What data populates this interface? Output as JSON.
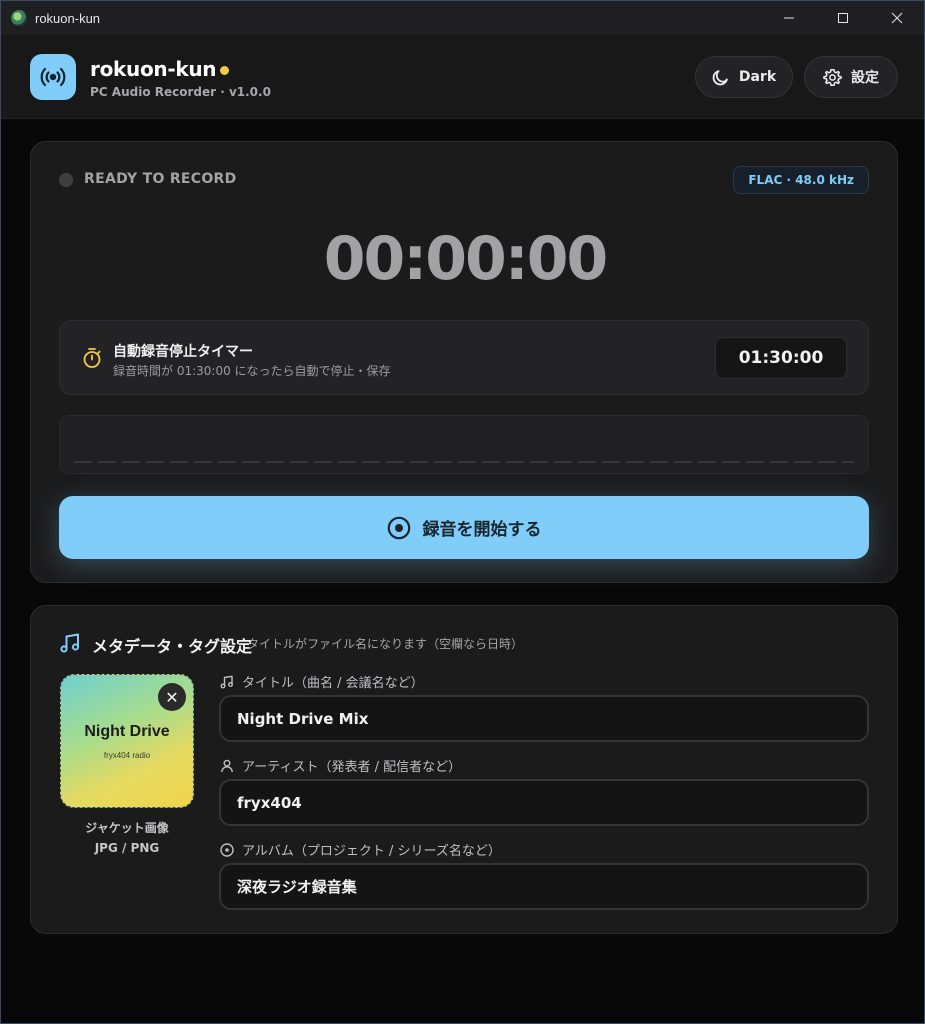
{
  "window": {
    "title": "rokuon-kun",
    "minimize_glyph": "—",
    "maximize_glyph": "☐",
    "close_glyph": "✕"
  },
  "header": {
    "app_name": "rokuon-kun",
    "subtitle": "PC Audio Recorder · v1.0.0",
    "theme_button_label": "Dark",
    "settings_button_label": "設定",
    "logo_icon": "broadcast-icon",
    "accent_color": "#7fcdf8",
    "dot_color": "#f3c94a"
  },
  "recorder": {
    "status": "READY TO RECORD",
    "format_badge": "FLAC · 48.0 kHz",
    "elapsed": "00:00:00",
    "auto_stop": {
      "title": "自動録音停止タイマー",
      "description": "録音時間が 01:30:00 になったら自動で停止・保存",
      "value": "01:30:00"
    },
    "record_button_label": "録音を開始する"
  },
  "metadata": {
    "title": "メタデータ・タグ設定",
    "hint": "タイトルがファイル名になります（空欄なら日時）",
    "cover": {
      "title": "Night Drive",
      "subtitle": "fryx404 radio",
      "remove_glyph": "✕",
      "caption_line1": "ジャケット画像",
      "caption_line2": "JPG / PNG"
    },
    "fields": [
      {
        "label": "タイトル（曲名 / 会議名など）",
        "value": "Night Drive Mix",
        "icon": "music-note-icon"
      },
      {
        "label": "アーティスト（発表者 / 配信者など）",
        "value": "fryx404",
        "icon": "person-icon"
      },
      {
        "label": "アルバム（プロジェクト / シリーズ名など）",
        "value": "深夜ラジオ録音集",
        "icon": "disc-icon"
      }
    ]
  }
}
